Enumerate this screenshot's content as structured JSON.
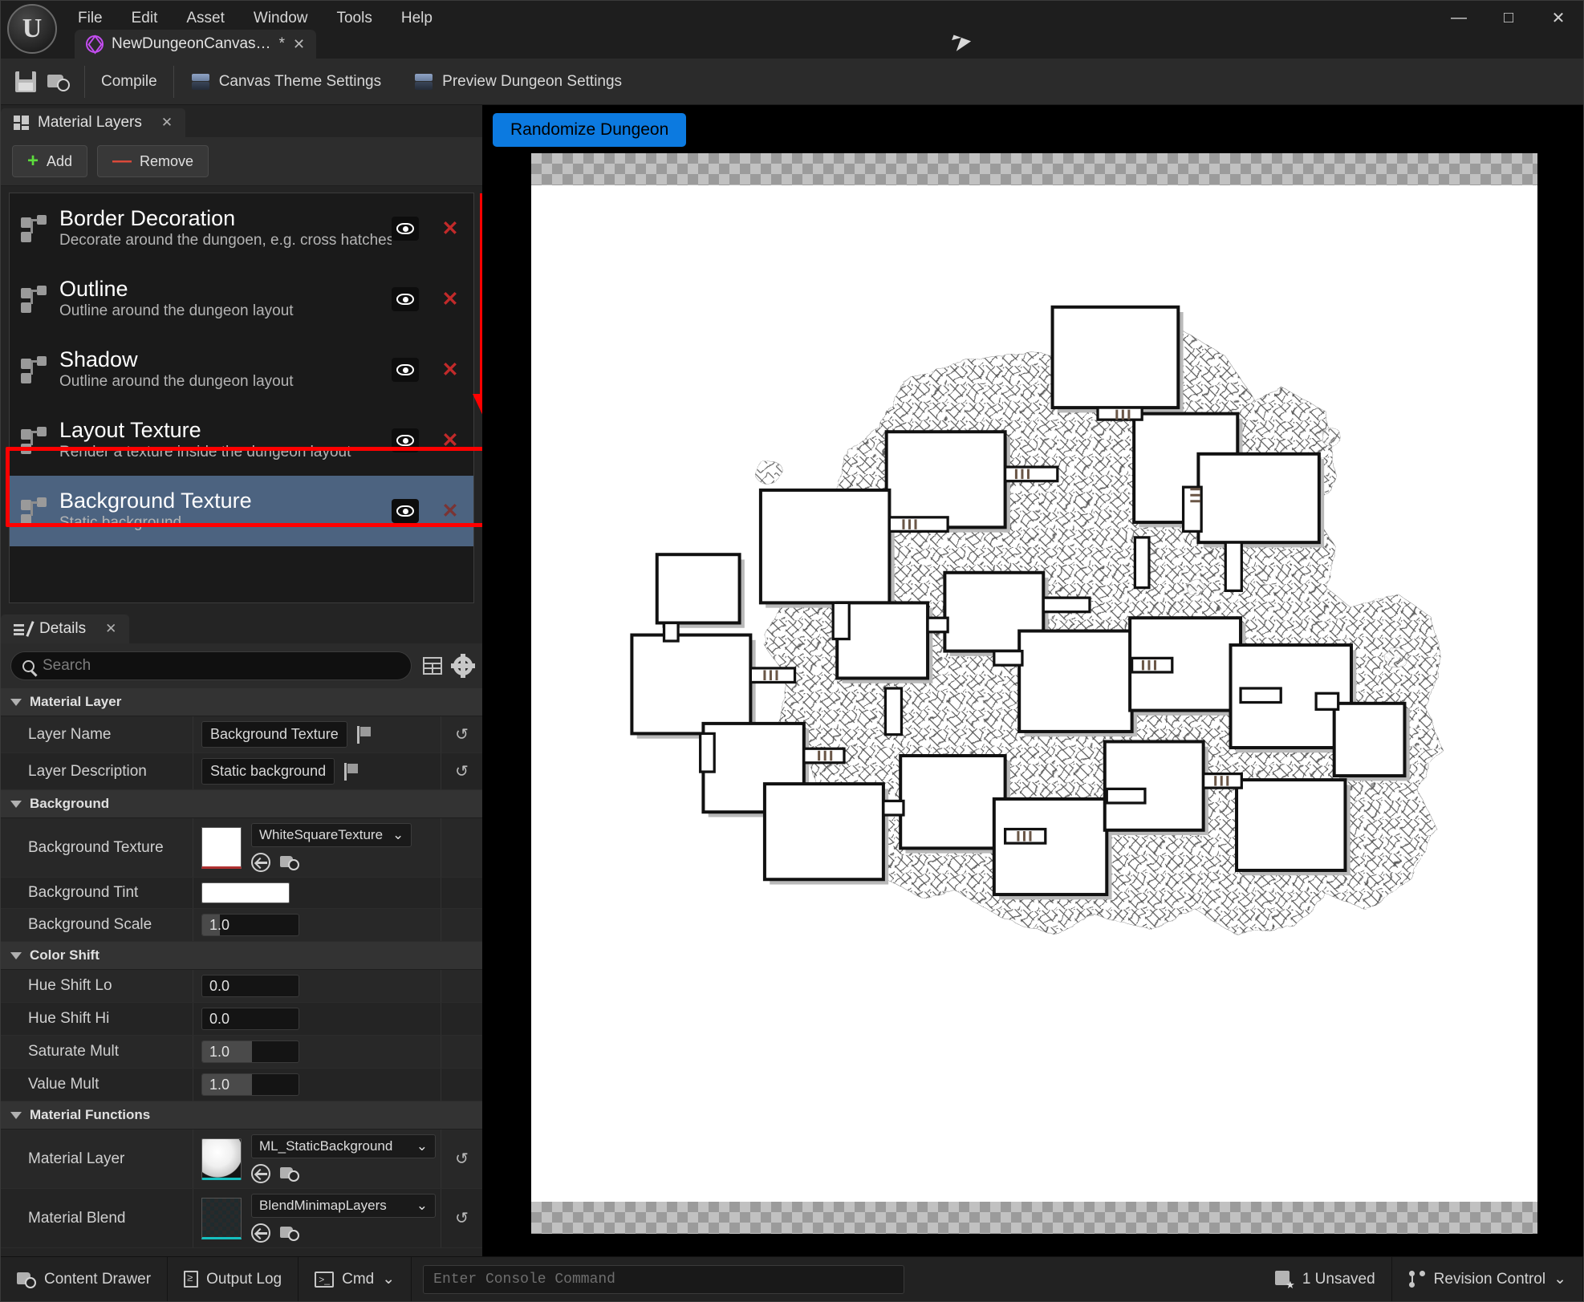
{
  "window": {
    "minimize_label": "—",
    "maximize_label": "□",
    "close_label": "✕"
  },
  "menubar": {
    "items": [
      {
        "label": "File"
      },
      {
        "label": "Edit"
      },
      {
        "label": "Asset"
      },
      {
        "label": "Window"
      },
      {
        "label": "Tools"
      },
      {
        "label": "Help"
      }
    ]
  },
  "asset_tab": {
    "label": "NewDungeonCanvas…",
    "dirty_marker": "*",
    "close_label": "✕"
  },
  "toolbar": {
    "compile_label": "Compile",
    "canvas_theme_label": "Canvas Theme Settings",
    "preview_dungeon_label": "Preview Dungeon Settings"
  },
  "material_layers_panel": {
    "tab_title": "Material Layers",
    "tab_close": "✕",
    "add_label": "Add",
    "add_glyph": "+",
    "remove_label": "Remove",
    "remove_glyph": "—",
    "layers": [
      {
        "name": "Border Decoration",
        "description": "Decorate around the dungoen, e.g. cross hatches",
        "visible": true,
        "delete_label": "✕",
        "selected": false
      },
      {
        "name": "Outline",
        "description": "Outline around the dungeon layout",
        "visible": true,
        "delete_label": "✕",
        "selected": false
      },
      {
        "name": "Shadow",
        "description": "Outline around the dungeon layout",
        "visible": true,
        "delete_label": "✕",
        "selected": false
      },
      {
        "name": "Layout  Texture",
        "description": "Render a texture inside the dungeon layout",
        "visible": true,
        "delete_label": "✕",
        "selected": false
      },
      {
        "name": "Background Texture",
        "description": "Static background",
        "visible": true,
        "delete_label": "✕",
        "selected": true
      }
    ]
  },
  "details_panel": {
    "tab_title": "Details",
    "tab_close": "✕",
    "search_placeholder": "Search",
    "search_value": "",
    "categories": {
      "material_layer": "Material Layer",
      "background": "Background",
      "color_shift": "Color Shift",
      "material_functions": "Material Functions"
    },
    "properties": {
      "layer_name": {
        "label": "Layer Name",
        "value": "Background Texture",
        "reset": "↺"
      },
      "layer_description": {
        "label": "Layer Description",
        "value": "Static background",
        "reset": "↺"
      },
      "background_texture": {
        "label": "Background Texture",
        "asset": "WhiteSquareTexture",
        "chevron": "⌄"
      },
      "background_tint": {
        "label": "Background Tint",
        "color": "#ffffff"
      },
      "background_scale": {
        "label": "Background Scale",
        "value": "1.0"
      },
      "hue_shift_lo": {
        "label": "Hue Shift Lo",
        "value": "0.0"
      },
      "hue_shift_hi": {
        "label": "Hue Shift Hi",
        "value": "0.0"
      },
      "saturate_mult": {
        "label": "Saturate Mult",
        "value": "1.0"
      },
      "value_mult": {
        "label": "Value Mult",
        "value": "1.0"
      },
      "material_layer": {
        "label": "Material Layer",
        "asset": "ML_StaticBackground",
        "chevron": "⌄",
        "reset": "↺"
      },
      "material_blend": {
        "label": "Material Blend",
        "asset": "BlendMinimapLayers",
        "chevron": "⌄",
        "reset": "↺"
      }
    }
  },
  "viewport": {
    "randomize_label": "Randomize Dungeon"
  },
  "statusbar": {
    "content_drawer_label": "Content Drawer",
    "output_log_label": "Output Log",
    "cmd_label": "Cmd",
    "cmd_chevron": "⌄",
    "console_placeholder": "Enter Console Command",
    "console_value": "",
    "unsaved_label": "1 Unsaved",
    "revision_control_label": "Revision Control",
    "revision_chevron": "⌄"
  },
  "colors": {
    "accent_blue": "#0c7ae0",
    "selection_blue": "#4c6380",
    "annotation_red": "#ff0000",
    "delete_red": "#c22a2a",
    "add_green": "#5ddd3d"
  }
}
